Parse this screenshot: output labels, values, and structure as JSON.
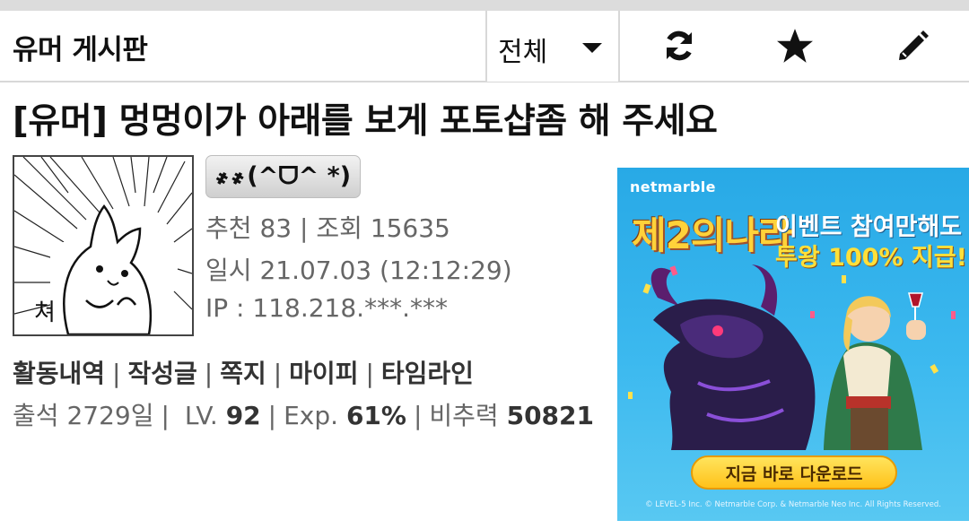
{
  "header": {
    "board_title": "유머 게시판",
    "filter_selected": "전체",
    "actions": [
      "refresh-icon",
      "star-icon",
      "pencil-icon"
    ]
  },
  "post": {
    "title": "[유머] 멍멍이가 아래를 보게 포토샵좀 해 주세요",
    "author_nick": "҂҂(^ᗜ^ *)",
    "recommend_label": "추천",
    "recommend_count": "83",
    "views_label": "조회",
    "views_count": "15635",
    "date_label": "일시",
    "date_value": "21.07.03 (12:12:29)",
    "ip_label": "IP",
    "ip_value": "118.218.***.***"
  },
  "user_links": [
    "활동내역",
    "작성글",
    "쪽지",
    "마이피",
    "타임라인"
  ],
  "user_stats": {
    "attendance_label": "출석",
    "attendance_value": "2729일",
    "level_label": "LV.",
    "level_value": "92",
    "exp_label": "Exp.",
    "exp_value": "61%",
    "power_label": "비추력",
    "power_value": "50821"
  },
  "ad": {
    "brand": "netmarble",
    "logo_text": "제2의나라",
    "headline_1": "이벤트 참여만해도",
    "headline_2": "투왕 100% 지급!",
    "cta": "지금 바로 다운로드",
    "copyright": "© LEVEL-5 Inc. © Netmarble Corp. & Netmarble Neo Inc. All Rights Reserved."
  },
  "colors": {
    "divider": "#d8d8d8",
    "meta_text": "#666666",
    "ad_bg": "#3cb9ef"
  }
}
